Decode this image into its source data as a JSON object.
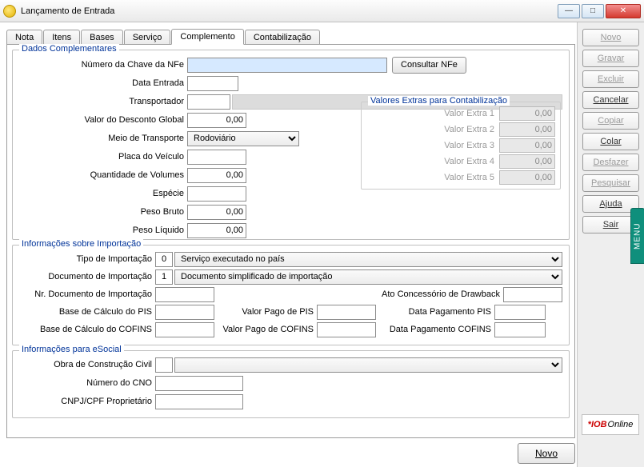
{
  "window": {
    "title": "Lançamento de Entrada",
    "min": "—",
    "max": "□",
    "close": "✕"
  },
  "tabs": [
    "Nota",
    "Itens",
    "Bases",
    "Serviço",
    "Complemento",
    "Contabilização"
  ],
  "active_tab": "Complemento",
  "g1": {
    "title": "Dados Complementares",
    "chave_lbl": "Número da Chave da NFe",
    "chave_val": "",
    "consultar": "Consultar NFe",
    "entrada_lbl": "Data Entrada",
    "entrada_val": "",
    "transp_lbl": "Transportador",
    "transp_val": "",
    "desc_lbl": "Valor do Desconto Global",
    "desc_val": "0,00",
    "meio_lbl": "Meio de Transporte",
    "meio_val": "Rodoviário",
    "placa_lbl": "Placa do Veículo",
    "placa_val": "",
    "qv_lbl": "Quantidade de Volumes",
    "qv_val": "0,00",
    "esp_lbl": "Espécie",
    "esp_val": "",
    "pb_lbl": "Peso Bruto",
    "pb_val": "0,00",
    "pl_lbl": "Peso Líquido",
    "pl_val": "0,00",
    "ve_title": "Valores Extras para Contabilização",
    "ve": [
      {
        "l": "Valor Extra 1",
        "v": "0,00"
      },
      {
        "l": "Valor Extra 2",
        "v": "0,00"
      },
      {
        "l": "Valor Extra 3",
        "v": "0,00"
      },
      {
        "l": "Valor Extra 4",
        "v": "0,00"
      },
      {
        "l": "Valor Extra 5",
        "v": "0,00"
      }
    ]
  },
  "g2": {
    "title": "Informações sobre Importação",
    "tipo_lbl": "Tipo de Importação",
    "tipo_code": "0",
    "tipo_val": "Serviço executado no país",
    "doc_lbl": "Documento de Importação",
    "doc_code": "1",
    "doc_val": "Documento simplificado de importação",
    "nr_lbl": "Nr. Documento de Importação",
    "nr_val": "",
    "ato_lbl": "Ato Concessório de Drawback",
    "ato_val": "",
    "bpis_lbl": "Base de Cálculo do PIS",
    "bpis_val": "",
    "vpis_lbl": "Valor Pago de PIS",
    "vpis_val": "",
    "dpis_lbl": "Data Pagamento PIS",
    "dpis_val": "",
    "bcof_lbl": "Base de Cálculo do COFINS",
    "bcof_val": "",
    "vcof_lbl": "Valor Pago de COFINS",
    "vcof_val": "",
    "dcof_lbl": "Data Pagamento COFINS",
    "dcof_val": ""
  },
  "g3": {
    "title": "Informações para eSocial",
    "obra_lbl": "Obra de Construção Civil",
    "obra_code": "",
    "obra_val": "",
    "cno_lbl": "Número do CNO",
    "cno_val": "",
    "cnpj_lbl": "CNPJ/CPF Proprietário",
    "cnpj_val": ""
  },
  "side": {
    "novo": "Novo",
    "gravar": "Gravar",
    "excluir": "Excluir",
    "cancelar": "Cancelar",
    "copiar": "Copiar",
    "colar": "Colar",
    "desfazer": "Desfazer",
    "pesquisar": "Pesquisar",
    "ajuda": "Ajuda",
    "sair": "Sair"
  },
  "footer": {
    "novo": "Novo"
  },
  "iob": {
    "a": "*IOB",
    "b": "Online"
  },
  "menu": "MENU"
}
